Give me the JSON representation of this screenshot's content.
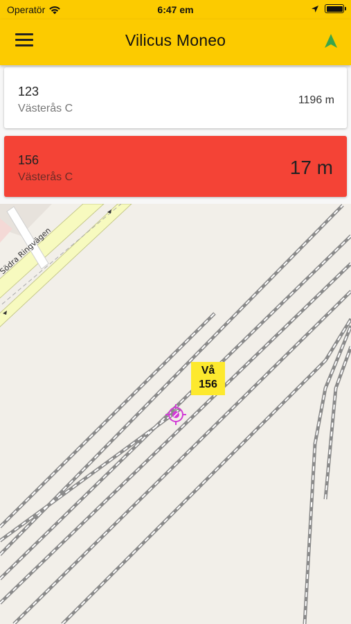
{
  "status_bar": {
    "carrier": "Operatör",
    "time": "6:47 em"
  },
  "app_bar": {
    "title": "Vilicus Moneo",
    "menu_icon": "hamburger-menu-icon",
    "nav_icon": "navigation-arrow-icon"
  },
  "trains": [
    {
      "number": "123",
      "station": "Västerås C",
      "distance": "1196 m"
    },
    {
      "number": "156",
      "station": "Västerås C",
      "distance": "17 m"
    }
  ],
  "map": {
    "road_name": "Södra Ringvägen",
    "marker_label_line1": "Vå",
    "marker_label_line2": "156",
    "location_icon": "crosshair-location-icon"
  },
  "colors": {
    "accent": "#fccb00",
    "alert": "#f44336",
    "map_background": "#f2efe9",
    "marker": "#d23bd6"
  }
}
